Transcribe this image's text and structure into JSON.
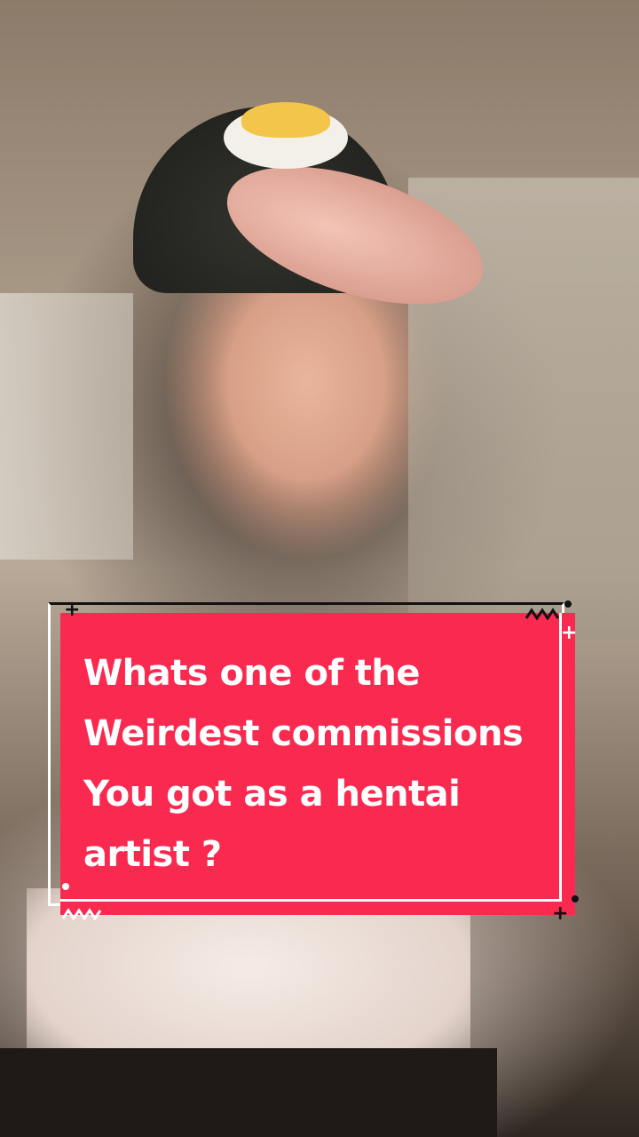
{
  "caption": {
    "lines": [
      "Whats one of the",
      "Weirdest commissions",
      "You got as a hentai",
      "artist ?"
    ]
  },
  "colors": {
    "card_background": "#f9294f",
    "card_text": "#ffffff",
    "accent_dark": "#111111"
  }
}
